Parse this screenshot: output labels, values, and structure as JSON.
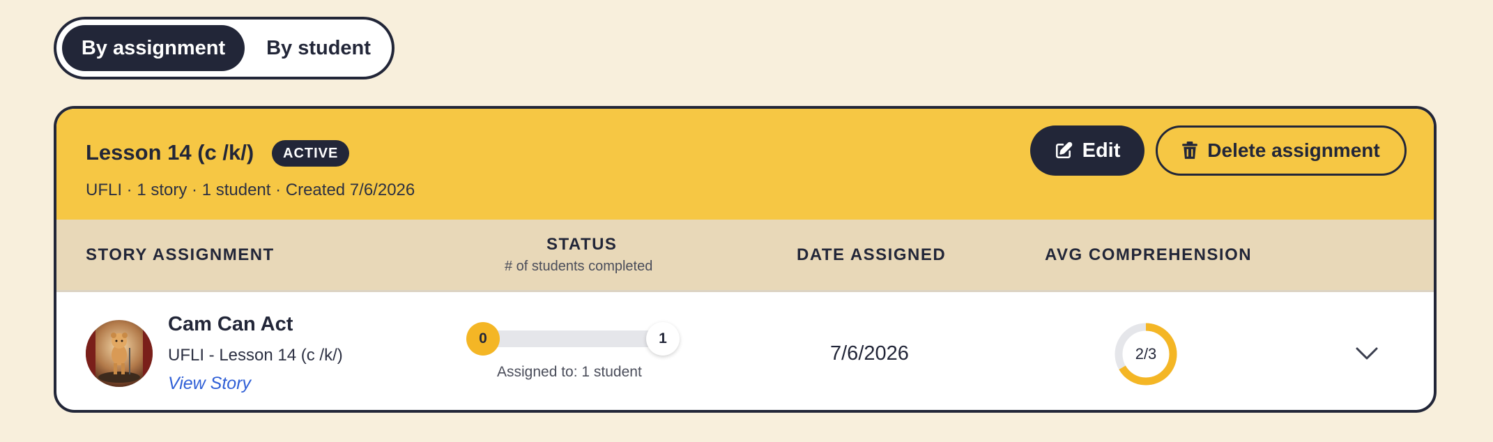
{
  "toggle": {
    "by_assignment": "By assignment",
    "by_student": "By student"
  },
  "assignment": {
    "title": "Lesson 14 (c /k/)",
    "badge": "ACTIVE",
    "meta": "UFLI · 1 story · 1 student · Created 7/6/2026",
    "edit_label": "Edit",
    "delete_label": "Delete assignment"
  },
  "columns": {
    "story": "STORY ASSIGNMENT",
    "status": "STATUS",
    "status_sub": "# of students completed",
    "date": "DATE ASSIGNED",
    "comprehension": "AVG COMPREHENSION"
  },
  "row": {
    "title": "Cam Can Act",
    "subtitle": "UFLI - Lesson 14 (c /k/)",
    "view_link": "View Story",
    "completed": "0",
    "total": "1",
    "completed_fraction": 0,
    "assigned_to": "Assigned to: 1 student",
    "date": "7/6/2026",
    "comprehension": "2/3",
    "comprehension_fraction": 0.6667
  },
  "colors": {
    "background": "#f8efdc",
    "header_yellow": "#f6c744",
    "column_band": "#e8d8b8",
    "dark": "#222638",
    "accent": "#f4b625",
    "link": "#2f5fd6"
  },
  "icons": {
    "edit": "pencil-square-icon",
    "delete": "trash-icon",
    "expand": "chevron-down-icon"
  }
}
